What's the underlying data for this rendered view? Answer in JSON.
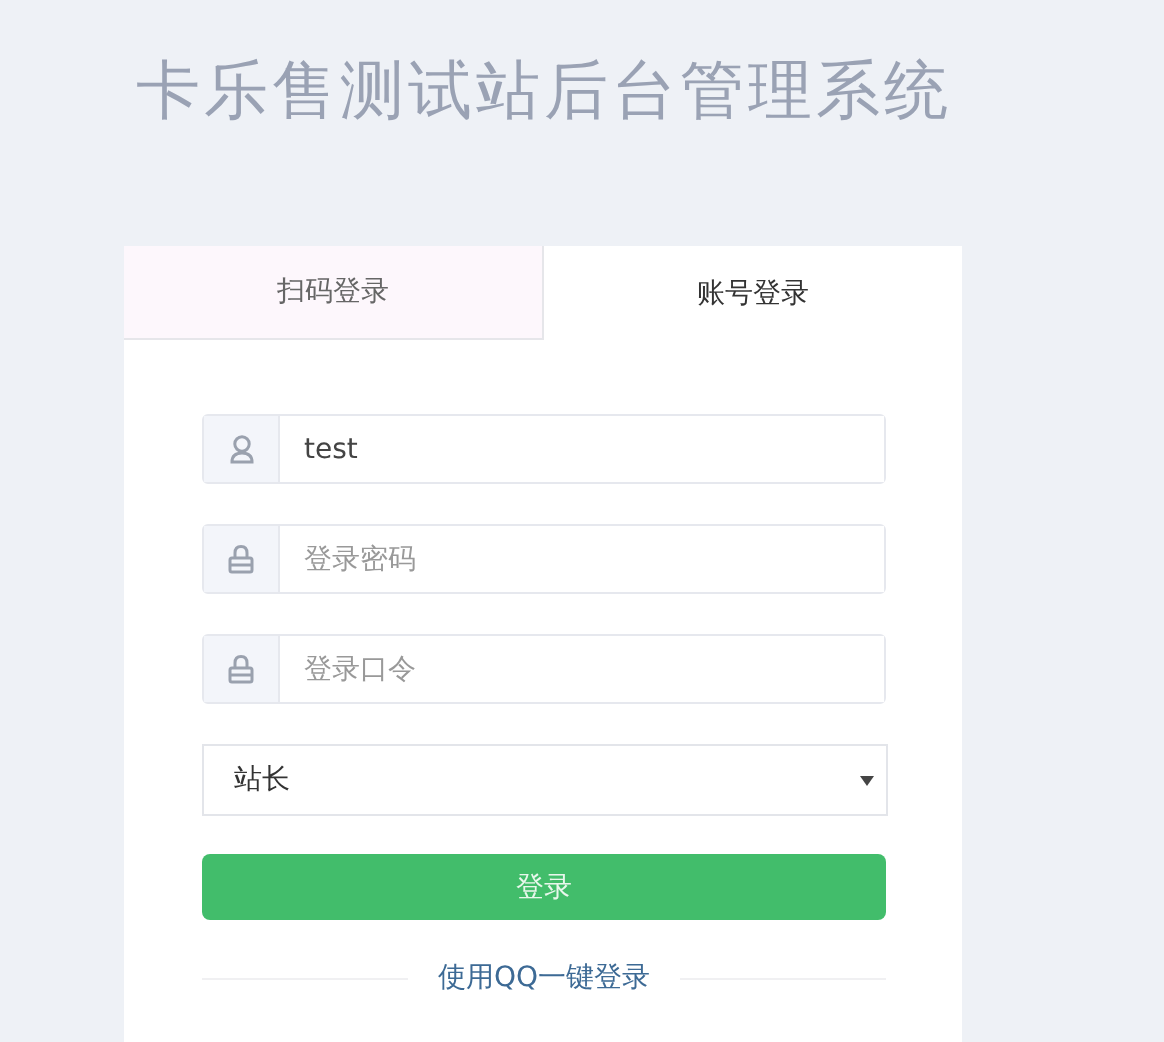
{
  "title": "卡乐售测试站后台管理系统",
  "tabs": [
    {
      "label": "扫码登录",
      "selected": false
    },
    {
      "label": "账号登录",
      "selected": true
    }
  ],
  "fields": [
    {
      "kind": "account",
      "value": "test"
    },
    {
      "kind": "secret",
      "placeholder": "登录密码"
    },
    {
      "kind": "secret",
      "placeholder": "登录口令"
    }
  ],
  "role_select": {
    "value": "站长"
  },
  "login_button": "登录",
  "qq_login_link": "使用QQ一键登录"
}
